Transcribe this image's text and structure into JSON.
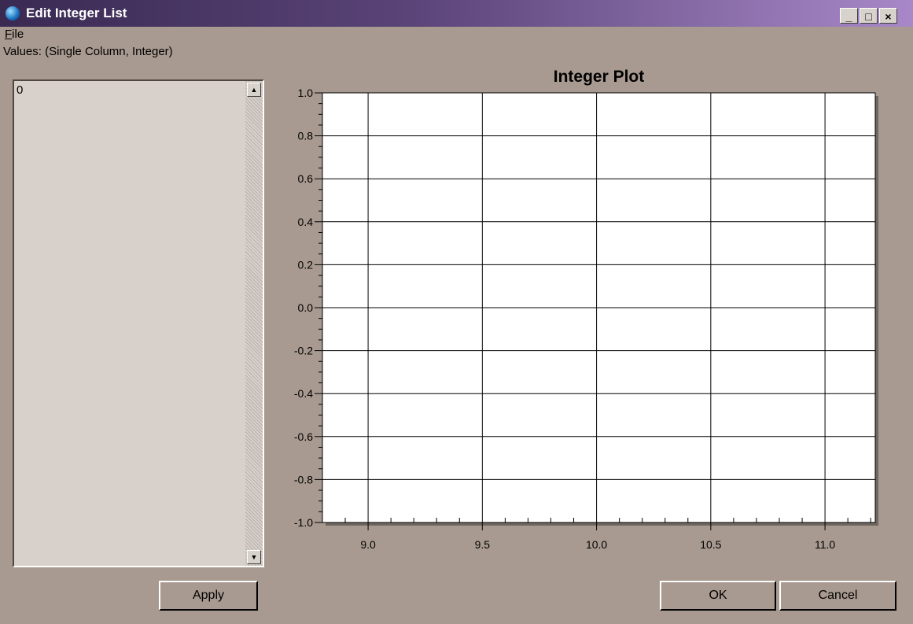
{
  "window": {
    "title": "Edit Integer List",
    "controls": {
      "minimize": "_",
      "maximize": "□",
      "close": "×"
    }
  },
  "menu": {
    "file_mnemonic": "F",
    "file_rest": "ile"
  },
  "list": {
    "label": "Values: (Single Column, Integer)",
    "items": [
      "0"
    ]
  },
  "buttons": {
    "apply": "Apply",
    "ok": "OK",
    "cancel": "Cancel"
  },
  "chart_data": {
    "type": "line",
    "title": "Integer Plot",
    "xlabel": "",
    "ylabel": "",
    "xlim": [
      8.8,
      11.22
    ],
    "ylim": [
      -1.0,
      1.0
    ],
    "x_ticks": [
      "9.0",
      "9.5",
      "10.0",
      "10.5",
      "11.0"
    ],
    "y_ticks": [
      "1.0",
      "0.8",
      "0.6",
      "0.4",
      "0.2",
      "0.0",
      "-0.2",
      "-0.4",
      "-0.6",
      "-0.8",
      "-1.0"
    ],
    "grid": true,
    "series": []
  }
}
